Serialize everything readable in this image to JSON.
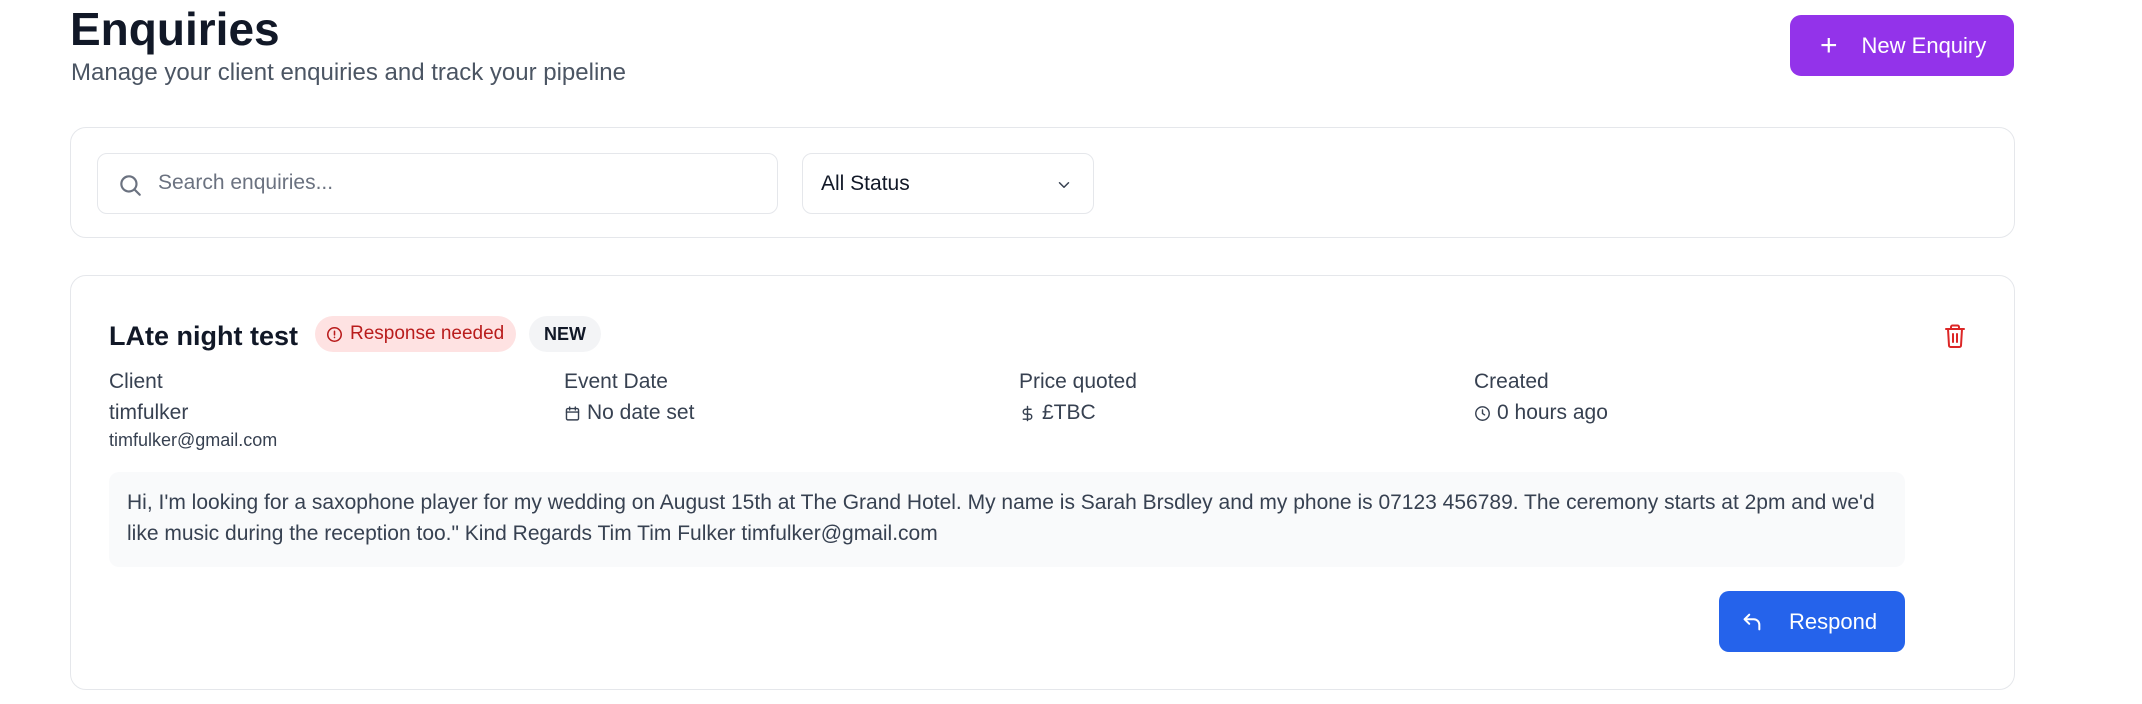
{
  "header": {
    "title": "Enquiries",
    "subtitle": "Manage your client enquiries and track your pipeline",
    "new_button_label": "New Enquiry",
    "new_button_icon": "plus-icon"
  },
  "filters": {
    "search_placeholder": "Search enquiries...",
    "search_value": "",
    "search_icon": "search-icon",
    "status_selected": "All Status",
    "status_icon": "chevron-down-icon"
  },
  "enquiry": {
    "title": "LAte night test",
    "response_badge": "Response needed",
    "status_badge": "NEW",
    "client_label": "Client",
    "client_name": "timfulker",
    "client_email": "timfulker@gmail.com",
    "event_date_label": "Event Date",
    "event_date_value": "No date set",
    "price_label": "Price quoted",
    "price_value": "£TBC",
    "created_label": "Created",
    "created_value": "0 hours ago",
    "message": "Hi, I'm looking for a saxophone player for my wedding on August 15th at The Grand Hotel. My name is Sarah Brsdley and my phone is 07123 456789. The ceremony starts at 2pm and we'd like music during the reception too.\" Kind Regards Tim Tim Fulker timfulker@gmail.com",
    "respond_label": "Respond"
  },
  "colors": {
    "primary_purple": "#9333ea",
    "respond_blue": "#2563eb",
    "badge_red_bg": "#fee2e2",
    "badge_red_text": "#b91c1c",
    "delete_red": "#dc2626"
  }
}
